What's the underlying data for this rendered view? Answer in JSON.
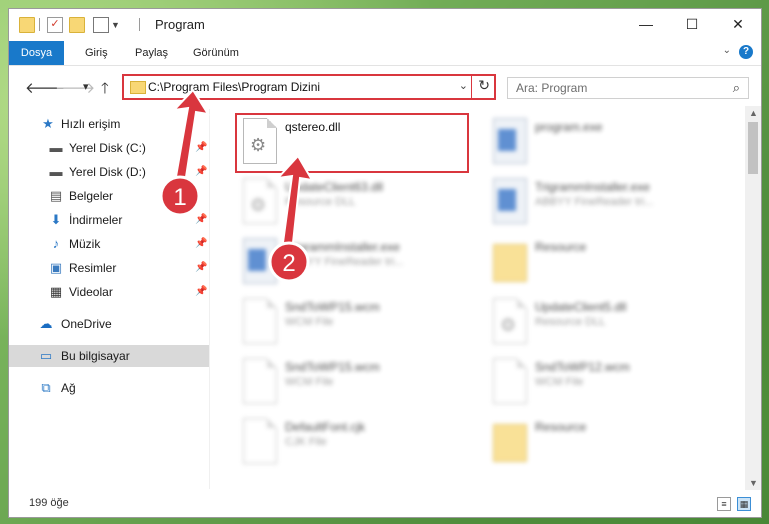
{
  "window": {
    "title": "Program"
  },
  "ribbon": {
    "tabs": [
      "Dosya",
      "Giriş",
      "Paylaş",
      "Görünüm"
    ],
    "help_icon": "?"
  },
  "nav": {
    "back": "🡐",
    "forward": "🡒",
    "recent": "▾",
    "up": "🡑",
    "path": "C:\\Program Files\\Program Dizini",
    "dropdown": "⌄",
    "refresh": "↻",
    "search_placeholder": "Ara: Program",
    "search_icon": "⌕"
  },
  "sidebar": {
    "items": [
      {
        "label": "Hızlı erişim",
        "icon": "★"
      },
      {
        "label": "Yerel Disk (C:)",
        "icon": "▬"
      },
      {
        "label": "Yerel Disk (D:)",
        "icon": "▬"
      },
      {
        "label": "Belgeler",
        "icon": "▤"
      },
      {
        "label": "İndirmeler",
        "icon": "⬇"
      },
      {
        "label": "Müzik",
        "icon": "♪"
      },
      {
        "label": "Resimler",
        "icon": "▣"
      },
      {
        "label": "Videolar",
        "icon": "▦"
      },
      {
        "label": "OneDrive",
        "icon": "☁"
      },
      {
        "label": "Bu bilgisayar",
        "icon": "▭"
      },
      {
        "label": "Ağ",
        "icon": "⧉"
      }
    ],
    "pin": "📌"
  },
  "files": [
    {
      "name": "qstereo.dll",
      "desc": "",
      "kind": "dll"
    },
    {
      "name": "program.exe",
      "desc": "",
      "kind": "exe"
    },
    {
      "name": "UpdateClient63.dll",
      "desc": "Resource DLL",
      "kind": "dll"
    },
    {
      "name": "TrigrammInstaller.exe",
      "desc": "ABBYY FineReader tri...",
      "kind": "exe"
    },
    {
      "name": "TrigrammInstaller.exe",
      "desc": "ABBYY FineReader tri...",
      "kind": "exe"
    },
    {
      "name": "Resource",
      "desc": "",
      "kind": "folder"
    },
    {
      "name": "SndToWP15.wcm",
      "desc": "WCM File",
      "kind": "doc"
    },
    {
      "name": "UpdateClient5.dll",
      "desc": "Resource DLL",
      "kind": "dll"
    },
    {
      "name": "SndToWP15.wcm",
      "desc": "WCM File",
      "kind": "doc"
    },
    {
      "name": "SndToWP12.wcm",
      "desc": "WCM File",
      "kind": "doc"
    },
    {
      "name": "DefaultFont.cjk",
      "desc": "CJK File",
      "kind": "doc"
    },
    {
      "name": "Resource",
      "desc": "",
      "kind": "folder"
    }
  ],
  "status": {
    "count": "199 öğe"
  },
  "annotations": {
    "step1": "1",
    "step2": "2"
  },
  "colors": {
    "accent": "#1979ca",
    "highlight": "#d9363e"
  }
}
